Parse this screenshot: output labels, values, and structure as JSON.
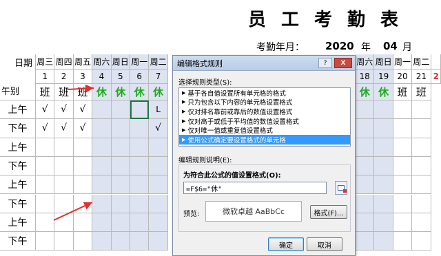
{
  "sheet": {
    "title": "员工考勤表",
    "month_label": "考勤年月：",
    "year": "2020",
    "year_unit": "年",
    "month": "04",
    "month_unit": "月",
    "header_date": "日期",
    "header_shift": "午别",
    "left_cols": [
      {
        "weekday": "周三",
        "day": "1",
        "shift": "班"
      },
      {
        "weekday": "周四",
        "day": "2",
        "shift": "班"
      },
      {
        "weekday": "周五",
        "day": "3",
        "shift": "班"
      },
      {
        "weekday": "周六",
        "day": "4",
        "shift": "休"
      },
      {
        "weekday": "周日",
        "day": "5",
        "shift": "休"
      },
      {
        "weekday": "周一",
        "day": "6",
        "shift": "休"
      },
      {
        "weekday": "周二",
        "day": "7",
        "shift": "休"
      }
    ],
    "right_cols": [
      {
        "weekday": "周六",
        "day": "18",
        "shift": "休"
      },
      {
        "weekday": "周日",
        "day": "19",
        "shift": "休"
      },
      {
        "weekday": "周一",
        "day": "20",
        "shift": "班"
      },
      {
        "weekday": "周二",
        "day": "21",
        "shift": "班"
      }
    ],
    "rows": [
      "上午",
      "下午",
      "上午",
      "下午",
      "上午",
      "下午",
      "上午",
      "下午"
    ],
    "check_mark": "√",
    "partial_entry": "L",
    "colors": {
      "rest": "#1faa1f",
      "weekend_fill": "#dde3f0",
      "arrow": "#e03030",
      "highlight_day": "#e03030"
    }
  },
  "dialog": {
    "title": "编辑格式规则",
    "help_label": "?",
    "close_label": "X",
    "select_type_label": "选择规则类型(S):",
    "rule_types": [
      "基于各自值设置所有单元格的格式",
      "只为包含以下内容的单元格设置格式",
      "仅对排名靠前或靠后的数值设置格式",
      "仅对高于或低于平均值的数值设置格式",
      "仅对唯一值或重复值设置格式",
      "使用公式确定要设置格式的单元格"
    ],
    "selected_rule_index": 5,
    "edit_desc_label": "编辑规则说明(E):",
    "formula_label": "为符合此公式的值设置格式(O):",
    "formula_value": "=F$6=\"休\"",
    "preview_label": "预览:",
    "preview_text": "微软卓越  AaBbCc",
    "format_button": "格式(F)...",
    "ok_button": "确定",
    "cancel_button": "取消"
  }
}
